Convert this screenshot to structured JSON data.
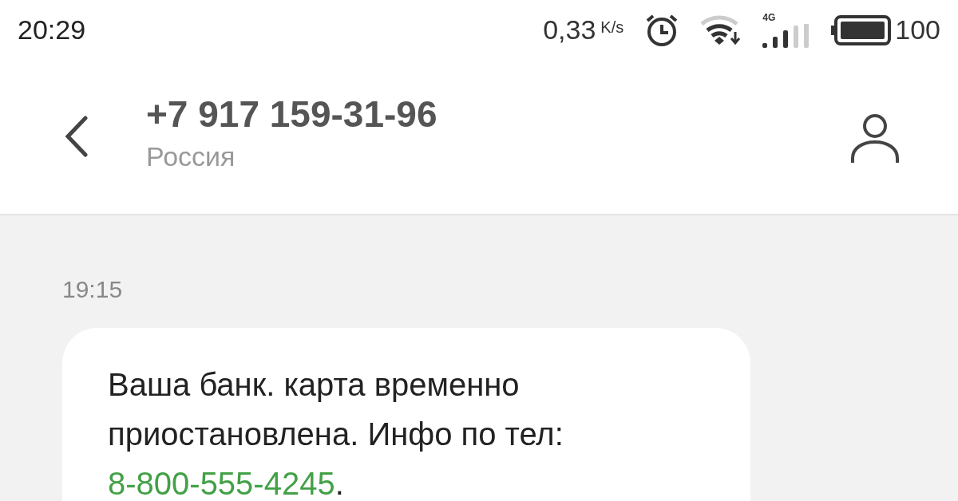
{
  "status_bar": {
    "time": "20:29",
    "speed": "0,33",
    "speed_unit": "K/s",
    "network": "4G",
    "battery": "100"
  },
  "header": {
    "title": "+7 917 159-31-96",
    "subtitle": "Россия"
  },
  "messages": [
    {
      "time": "19:15",
      "text": "Ваша банк. карта временно приостановлена. Инфо по тел: ",
      "link": "8-800-555-4245",
      "after": "."
    }
  ]
}
